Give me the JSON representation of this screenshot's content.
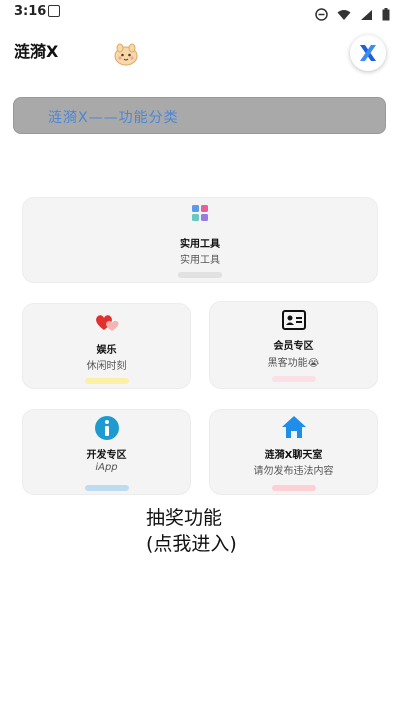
{
  "status": {
    "time": "3:16"
  },
  "header": {
    "title": "涟漪X"
  },
  "banner": {
    "text": "涟漪X——功能分类"
  },
  "cards": [
    {
      "title": "实用工具",
      "subtitle": "实用工具",
      "bar_color": "#e1e1e1",
      "icon": "app-grid-icon"
    },
    {
      "title": "娱乐",
      "subtitle": "休闲时刻",
      "bar_color": "#fbf0a5",
      "icon": "hearts-icon"
    },
    {
      "title": "会员专区",
      "subtitle": "黑客功能😭",
      "bar_color": "#fbe0e6",
      "icon": "id-card-icon"
    },
    {
      "title": "开发专区",
      "subtitle": "iApp",
      "bar_color": "#bedbf4",
      "icon": "info-icon"
    },
    {
      "title": "涟漪X聊天室",
      "subtitle": "请勿发布违法内容",
      "bar_color": "#fdd0d6",
      "icon": "home-icon"
    }
  ],
  "lottery": {
    "line1": "抽奖功能",
    "line2": "(点我进入)"
  }
}
